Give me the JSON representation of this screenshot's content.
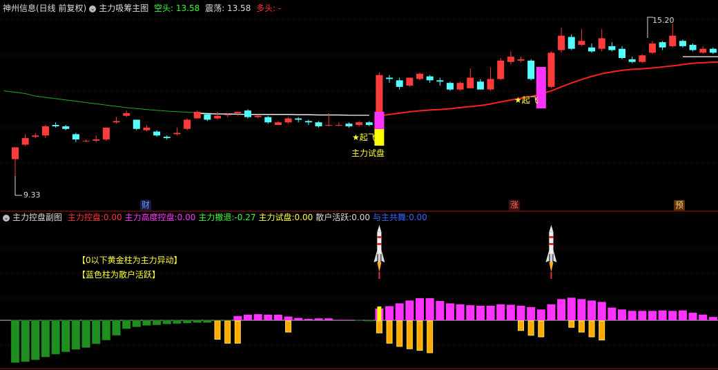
{
  "main_header": {
    "stock": "神州信息(日线 前复权)",
    "indicator": "主力吸筹主图",
    "bear_label": "空头:",
    "bear_value": "13.58",
    "range_label": "震荡:",
    "range_value": "13.58",
    "bull_label": "多头:",
    "bull_value": "-"
  },
  "sub_header": {
    "indicator": "主力控盘副图",
    "items": [
      {
        "label": "主力控盘:",
        "value": "0.00",
        "color": "#ff3333"
      },
      {
        "label": "主力高度控盘:",
        "value": "0.00",
        "color": "#ff33ff"
      },
      {
        "label": "主力撤退:",
        "value": "-0.27",
        "color": "#33ff33"
      },
      {
        "label": "主力试盘:",
        "value": "0.00",
        "color": "#ffff33"
      },
      {
        "label": "散户活跃:",
        "value": "0.00",
        "color": "#dddddd"
      },
      {
        "label": "与主共舞:",
        "value": "0.00",
        "color": "#3366ff"
      }
    ]
  },
  "annotations": {
    "takeoff_1": "起飞",
    "takeoff_2": "起飞",
    "test_label": "主力试盘",
    "high_label": "15.20",
    "low_label": "9.33",
    "note_1": "【0以下黄金柱为主力异动】",
    "note_2": "【蓝色柱为散户活跃】",
    "marker_cai": "财",
    "marker_zhang": "涨",
    "marker_yu": "预"
  },
  "colors": {
    "up": "#ff3b3b",
    "down": "#54ffff",
    "ma": "#ff2020",
    "long_ma": "#22aa22",
    "control": "#ff33ff",
    "retreat": "#1f8f1f",
    "gold": "#ffaa00",
    "test": "#ff33ff"
  },
  "chart_data": [
    {
      "type": "candlestick",
      "title": "主力吸筹主图",
      "ylim": [
        9.0,
        15.7
      ],
      "candles": [
        [
          10.3,
          10.75,
          10.55,
          9.33
        ],
        [
          10.85,
          11.1,
          11.25,
          10.8
        ],
        [
          11.15,
          11.2,
          11.3,
          11.1
        ],
        [
          11.2,
          11.55,
          11.6,
          11.1
        ],
        [
          11.6,
          11.55,
          11.7,
          11.5
        ],
        [
          11.55,
          11.45,
          11.6,
          11.4
        ],
        [
          11.25,
          11.05,
          11.3,
          10.95
        ],
        [
          11.0,
          11.0,
          11.05,
          10.95
        ],
        [
          11.0,
          11.05,
          11.2,
          10.95
        ],
        [
          11.05,
          11.5,
          11.5,
          11.0
        ],
        [
          11.7,
          11.75,
          11.9,
          11.65
        ],
        [
          11.95,
          12.05,
          12.15,
          11.9
        ],
        [
          11.8,
          11.45,
          11.8,
          11.4
        ],
        [
          11.4,
          11.5,
          11.6,
          11.35
        ],
        [
          11.35,
          11.2,
          11.4,
          11.15
        ],
        [
          11.15,
          11.1,
          11.2,
          11.05
        ],
        [
          11.25,
          11.3,
          11.5,
          11.2
        ],
        [
          11.45,
          11.8,
          11.85,
          11.4
        ],
        [
          11.85,
          12.1,
          12.15,
          11.85
        ],
        [
          12.0,
          11.8,
          12.05,
          11.75
        ],
        [
          11.85,
          11.95,
          12.1,
          11.8
        ],
        [
          12.0,
          12.0,
          12.05,
          11.9
        ],
        [
          12.05,
          12.1,
          12.1,
          11.95
        ],
        [
          12.15,
          11.9,
          12.2,
          11.85
        ],
        [
          11.9,
          11.95,
          12.0,
          11.85
        ],
        [
          11.9,
          11.7,
          11.95,
          11.65
        ],
        [
          11.6,
          11.7,
          11.75,
          11.6
        ],
        [
          11.7,
          11.85,
          11.9,
          11.65
        ],
        [
          11.85,
          11.8,
          11.9,
          11.7
        ],
        [
          11.75,
          11.7,
          11.8,
          11.6
        ],
        [
          11.7,
          11.55,
          11.75,
          11.5
        ],
        [
          11.6,
          11.6,
          12.05,
          11.55
        ],
        [
          11.6,
          11.6,
          11.7,
          11.55
        ],
        [
          11.65,
          11.55,
          11.7,
          11.5
        ],
        [
          11.6,
          11.7,
          11.75,
          11.55
        ],
        [
          11.7,
          11.6,
          11.75,
          11.55
        ],
        [
          12.05,
          13.5,
          13.6,
          12.0
        ],
        [
          13.4,
          13.35,
          13.5,
          13.2
        ],
        [
          13.3,
          13.05,
          13.4,
          12.95
        ],
        [
          13.1,
          13.4,
          13.4,
          13.05
        ],
        [
          13.35,
          13.55,
          13.6,
          13.3
        ],
        [
          13.45,
          13.3,
          13.5,
          13.2
        ],
        [
          13.3,
          13.25,
          13.4,
          13.1
        ],
        [
          13.2,
          12.95,
          13.25,
          12.9
        ],
        [
          12.95,
          13.2,
          13.25,
          12.9
        ],
        [
          13.0,
          13.4,
          13.75,
          13.0
        ],
        [
          13.25,
          12.95,
          13.35,
          12.95
        ],
        [
          12.95,
          13.35,
          13.8,
          12.9
        ],
        [
          13.35,
          14.05,
          14.15,
          13.3
        ],
        [
          14.0,
          14.2,
          14.4,
          13.9
        ],
        [
          14.05,
          14.1,
          14.2,
          14.0
        ],
        [
          14.05,
          13.35,
          14.1,
          13.3
        ],
        [
          12.95,
          13.0,
          13.2,
          12.75
        ],
        [
          13.05,
          14.35,
          14.4,
          13.0
        ],
        [
          14.45,
          15.0,
          15.3,
          14.35
        ],
        [
          14.95,
          14.5,
          15.05,
          14.45
        ],
        [
          14.65,
          14.8,
          15.25,
          14.6
        ],
        [
          14.55,
          14.4,
          14.7,
          14.35
        ],
        [
          14.5,
          14.9,
          15.25,
          14.4
        ],
        [
          14.6,
          14.45,
          14.75,
          14.4
        ],
        [
          14.5,
          14.15,
          14.6,
          14.1
        ],
        [
          14.1,
          14.0,
          14.2,
          13.95
        ],
        [
          14.0,
          14.25,
          14.3,
          13.95
        ],
        [
          14.35,
          14.7,
          14.8,
          14.3
        ],
        [
          14.75,
          14.55,
          14.8,
          14.45
        ],
        [
          14.6,
          15.0,
          15.45,
          14.55
        ],
        [
          14.8,
          14.6,
          14.85,
          14.55
        ],
        [
          14.65,
          14.45,
          14.7,
          14.4
        ],
        [
          14.35,
          14.5,
          14.6,
          14.3
        ],
        [
          14.5,
          14.35,
          14.55,
          14.3
        ],
        [
          14.4,
          14.3,
          14.45,
          14.15
        ],
        [
          14.4,
          14.2,
          14.45,
          14.1
        ]
      ],
      "ma": [
        11.4,
        11.4,
        11.4,
        11.4,
        11.4,
        11.4,
        11.4,
        11.4,
        11.4,
        11.4,
        11.4,
        11.4,
        11.4,
        11.4,
        11.4,
        11.4,
        11.4,
        11.4,
        11.4,
        11.4,
        11.4,
        11.4,
        11.4,
        11.4,
        11.4,
        11.4,
        11.4,
        11.4,
        11.4,
        11.4,
        11.4,
        11.4,
        11.4,
        11.4,
        11.4,
        11.4,
        11.95,
        12.0,
        12.05,
        12.1,
        12.14,
        12.17,
        12.19,
        12.22,
        12.26,
        12.3,
        12.34,
        12.4,
        12.48,
        12.55,
        12.62,
        12.68,
        12.78,
        12.9,
        13.05,
        13.2,
        13.33,
        13.45,
        13.55,
        13.62,
        13.68,
        13.72,
        13.74,
        13.77,
        13.81,
        13.85,
        13.9,
        13.95,
        13.97,
        13.99,
        14.0,
        14.0
      ],
      "long_ma": [
        12.9,
        12.85,
        12.8,
        12.7,
        12.65,
        12.6,
        12.55,
        12.5,
        12.45,
        12.4,
        12.35,
        12.3,
        12.25,
        12.22,
        12.18,
        12.15,
        12.12,
        12.1,
        12.08,
        12.06,
        12.04
      ],
      "trend_line": [
        12.04,
        12.03,
        12.02,
        12.02,
        12.01,
        12.0,
        12.0,
        12.0,
        12.0,
        12.0,
        11.99,
        11.99,
        11.98,
        11.98,
        11.98,
        11.97,
        11.97,
        11.97
      ],
      "flat_line": 14.2,
      "markers": [
        "财",
        "涨",
        "预"
      ]
    },
    {
      "type": "bar",
      "title": "主力控盘副图",
      "ylim": [
        -1.0,
        0.6
      ],
      "values": [
        -0.9,
        -0.88,
        -0.84,
        -0.78,
        -0.72,
        -0.67,
        -0.62,
        -0.58,
        -0.5,
        -0.42,
        -0.32,
        -0.18,
        -0.14,
        -0.11,
        -0.1,
        -0.08,
        -0.07,
        -0.06,
        -0.05,
        -0.05,
        -0.02,
        -0.01,
        0.09,
        0.12,
        0.13,
        0.12,
        0.12,
        0.08,
        0.05,
        0.03,
        0.04,
        0.04,
        0.01,
        0.01,
        -0.01,
        -0.02,
        0.25,
        0.3,
        0.36,
        0.42,
        0.47,
        0.47,
        0.41,
        0.36,
        0.34,
        0.32,
        0.31,
        0.31,
        0.34,
        0.33,
        0.31,
        0.28,
        0.23,
        0.34,
        0.45,
        0.48,
        0.45,
        0.42,
        0.39,
        0.27,
        0.23,
        0.2,
        0.2,
        0.2,
        0.21,
        0.2,
        0.21,
        0.16,
        0.12,
        0.07,
        0.02,
        0.01
      ],
      "gold": [
        0,
        0,
        0,
        0,
        0,
        0,
        0,
        0,
        0,
        0,
        0,
        0,
        0,
        0,
        0,
        0,
        0,
        0,
        0,
        0,
        0.23,
        0.28,
        0.28,
        0,
        0,
        0,
        0,
        0.14,
        0,
        0,
        0,
        0,
        0,
        0,
        0,
        0,
        0.15,
        0.28,
        0.32,
        0.35,
        0.37,
        0.4,
        0,
        0,
        0,
        0,
        0,
        0,
        0,
        0,
        0.12,
        0.18,
        0.2,
        0,
        0,
        0.08,
        0.14,
        0.2,
        0.24,
        0,
        0,
        0,
        0,
        0,
        0,
        0,
        0,
        0,
        0,
        0,
        0,
        0
      ],
      "test_bar_index": 36,
      "rockets": [
        36,
        53
      ]
    }
  ]
}
